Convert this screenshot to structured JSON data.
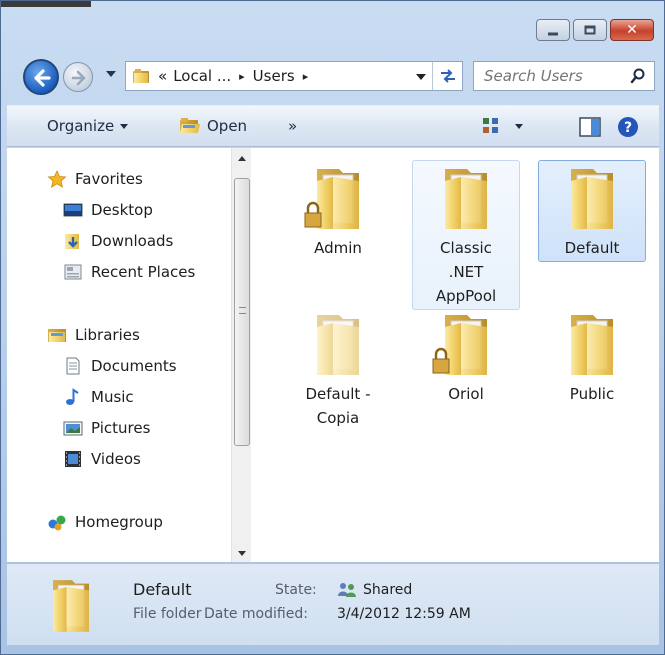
{
  "window": {
    "caption": {
      "minimize_icon": "minimize-icon",
      "maximize_icon": "maximize-icon",
      "close_glyph": "✕"
    }
  },
  "address": {
    "overflow": "«",
    "segments": [
      "Local ...",
      "Users"
    ],
    "separator": "▸"
  },
  "search": {
    "placeholder": "Search Users"
  },
  "toolbar": {
    "organize": "Organize",
    "open": "Open",
    "more": "»"
  },
  "nav": {
    "favorites": "Favorites",
    "desktop": "Desktop",
    "downloads": "Downloads",
    "recent": "Recent Places",
    "libraries": "Libraries",
    "documents": "Documents",
    "music": "Music",
    "pictures": "Pictures",
    "videos": "Videos",
    "homegroup": "Homegroup"
  },
  "files": [
    {
      "line1": "Admin",
      "line2": "",
      "line3": "",
      "locked": true
    },
    {
      "line1": "Classic",
      "line2": ".NET",
      "line3": "AppPool",
      "locked": false
    },
    {
      "line1": "Default",
      "line2": "",
      "line3": "",
      "locked": false
    },
    {
      "line1": "Default -",
      "line2": "Copia",
      "line3": "",
      "locked": false
    },
    {
      "line1": "Oriol",
      "line2": "",
      "line3": "",
      "locked": true
    },
    {
      "line1": "Public",
      "line2": "",
      "line3": "",
      "locked": false
    }
  ],
  "details": {
    "name": "Default",
    "type": "File folder",
    "state_label": "State:",
    "state_value": "Shared",
    "modified_label": "Date modified:",
    "modified_value": "3/4/2012 12:59 AM"
  },
  "colors": {
    "selection": "#cfe2fa",
    "accent": "#2d62b4",
    "folder": "#f2d36b"
  }
}
